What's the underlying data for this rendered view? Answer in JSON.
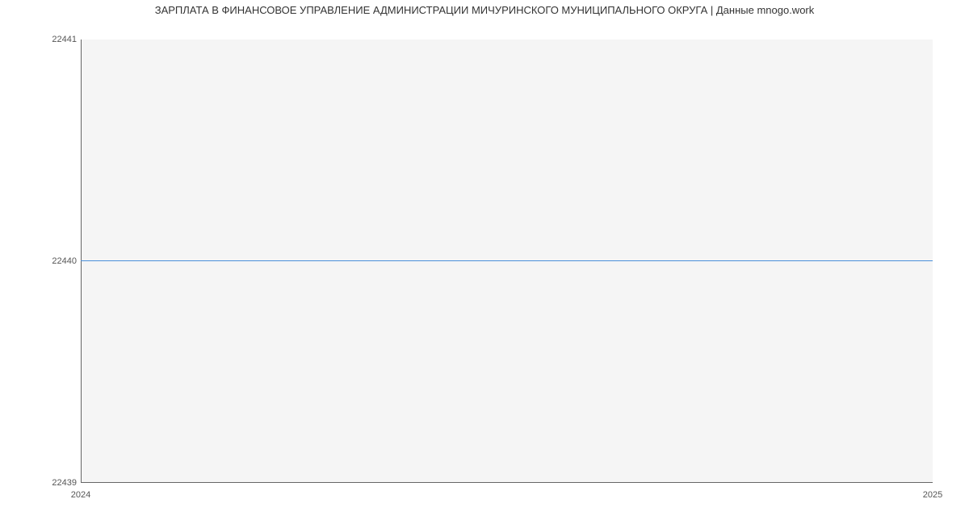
{
  "chart_data": {
    "type": "line",
    "title": "ЗАРПЛАТА В ФИНАНСОВОЕ УПРАВЛЕНИЕ АДМИНИСТРАЦИИ МИЧУРИНСКОГО МУНИЦИПАЛЬНОГО ОКРУГА | Данные mnogo.work",
    "x": [
      "2024",
      "2025"
    ],
    "values": [
      22440,
      22440
    ],
    "xlabel": "",
    "ylabel": "",
    "ylim": [
      22439,
      22441
    ],
    "y_ticks": [
      "22439",
      "22440",
      "22441"
    ],
    "x_ticks": [
      "2024",
      "2025"
    ]
  }
}
